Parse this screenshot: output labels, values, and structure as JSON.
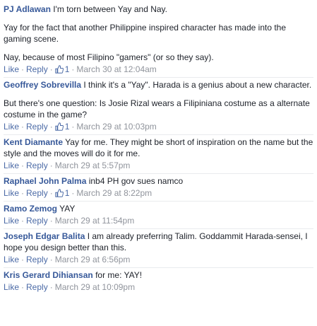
{
  "actions": {
    "like": "Like",
    "reply": "Reply",
    "separator": "·"
  },
  "comments": [
    {
      "author": "PJ Adlawan",
      "paragraphs": [
        "I'm torn between Yay and Nay.",
        "Yay for the fact that another Philippine inspired character has made into the gaming scene.",
        "Nay, because of most Filipino \"gamers\" (or so they say)."
      ],
      "likes": "1",
      "timestamp": "March 30 at 12:04am"
    },
    {
      "author": "Geoffrey Sobrevilla",
      "paragraphs": [
        "I think it's a \"Yay\". Harada is a genius about a new character.",
        "But there's one question: Is Josie Rizal wears a Filipiniana costume as a alternate costume in the game?"
      ],
      "likes": "1",
      "timestamp": "March 29 at 10:03pm"
    },
    {
      "author": "Kent Diamante",
      "paragraphs": [
        "Yay for me. They might be short of inspiration on the name but the style and the moves will do it for me."
      ],
      "likes": "",
      "timestamp": "March 29 at 5:57pm"
    },
    {
      "author": "Raphael John Palma",
      "paragraphs": [
        "inb4 PH gov sues namco"
      ],
      "likes": "1",
      "timestamp": "March 29 at 8:22pm"
    },
    {
      "author": "Ramo Zemog",
      "paragraphs": [
        "YAY"
      ],
      "likes": "",
      "timestamp": "March 29 at 11:54pm"
    },
    {
      "author": "Joseph Edgar Balita",
      "paragraphs": [
        "I am already preferring Talim. Goddammit Harada-sensei, I hope you design better than this."
      ],
      "likes": "",
      "timestamp": "March 29 at 6:56pm"
    },
    {
      "author": "Kris Gerard Dihiansan",
      "paragraphs": [
        "for me: YAY!"
      ],
      "likes": "",
      "timestamp": "March 29 at 10:09pm"
    }
  ]
}
